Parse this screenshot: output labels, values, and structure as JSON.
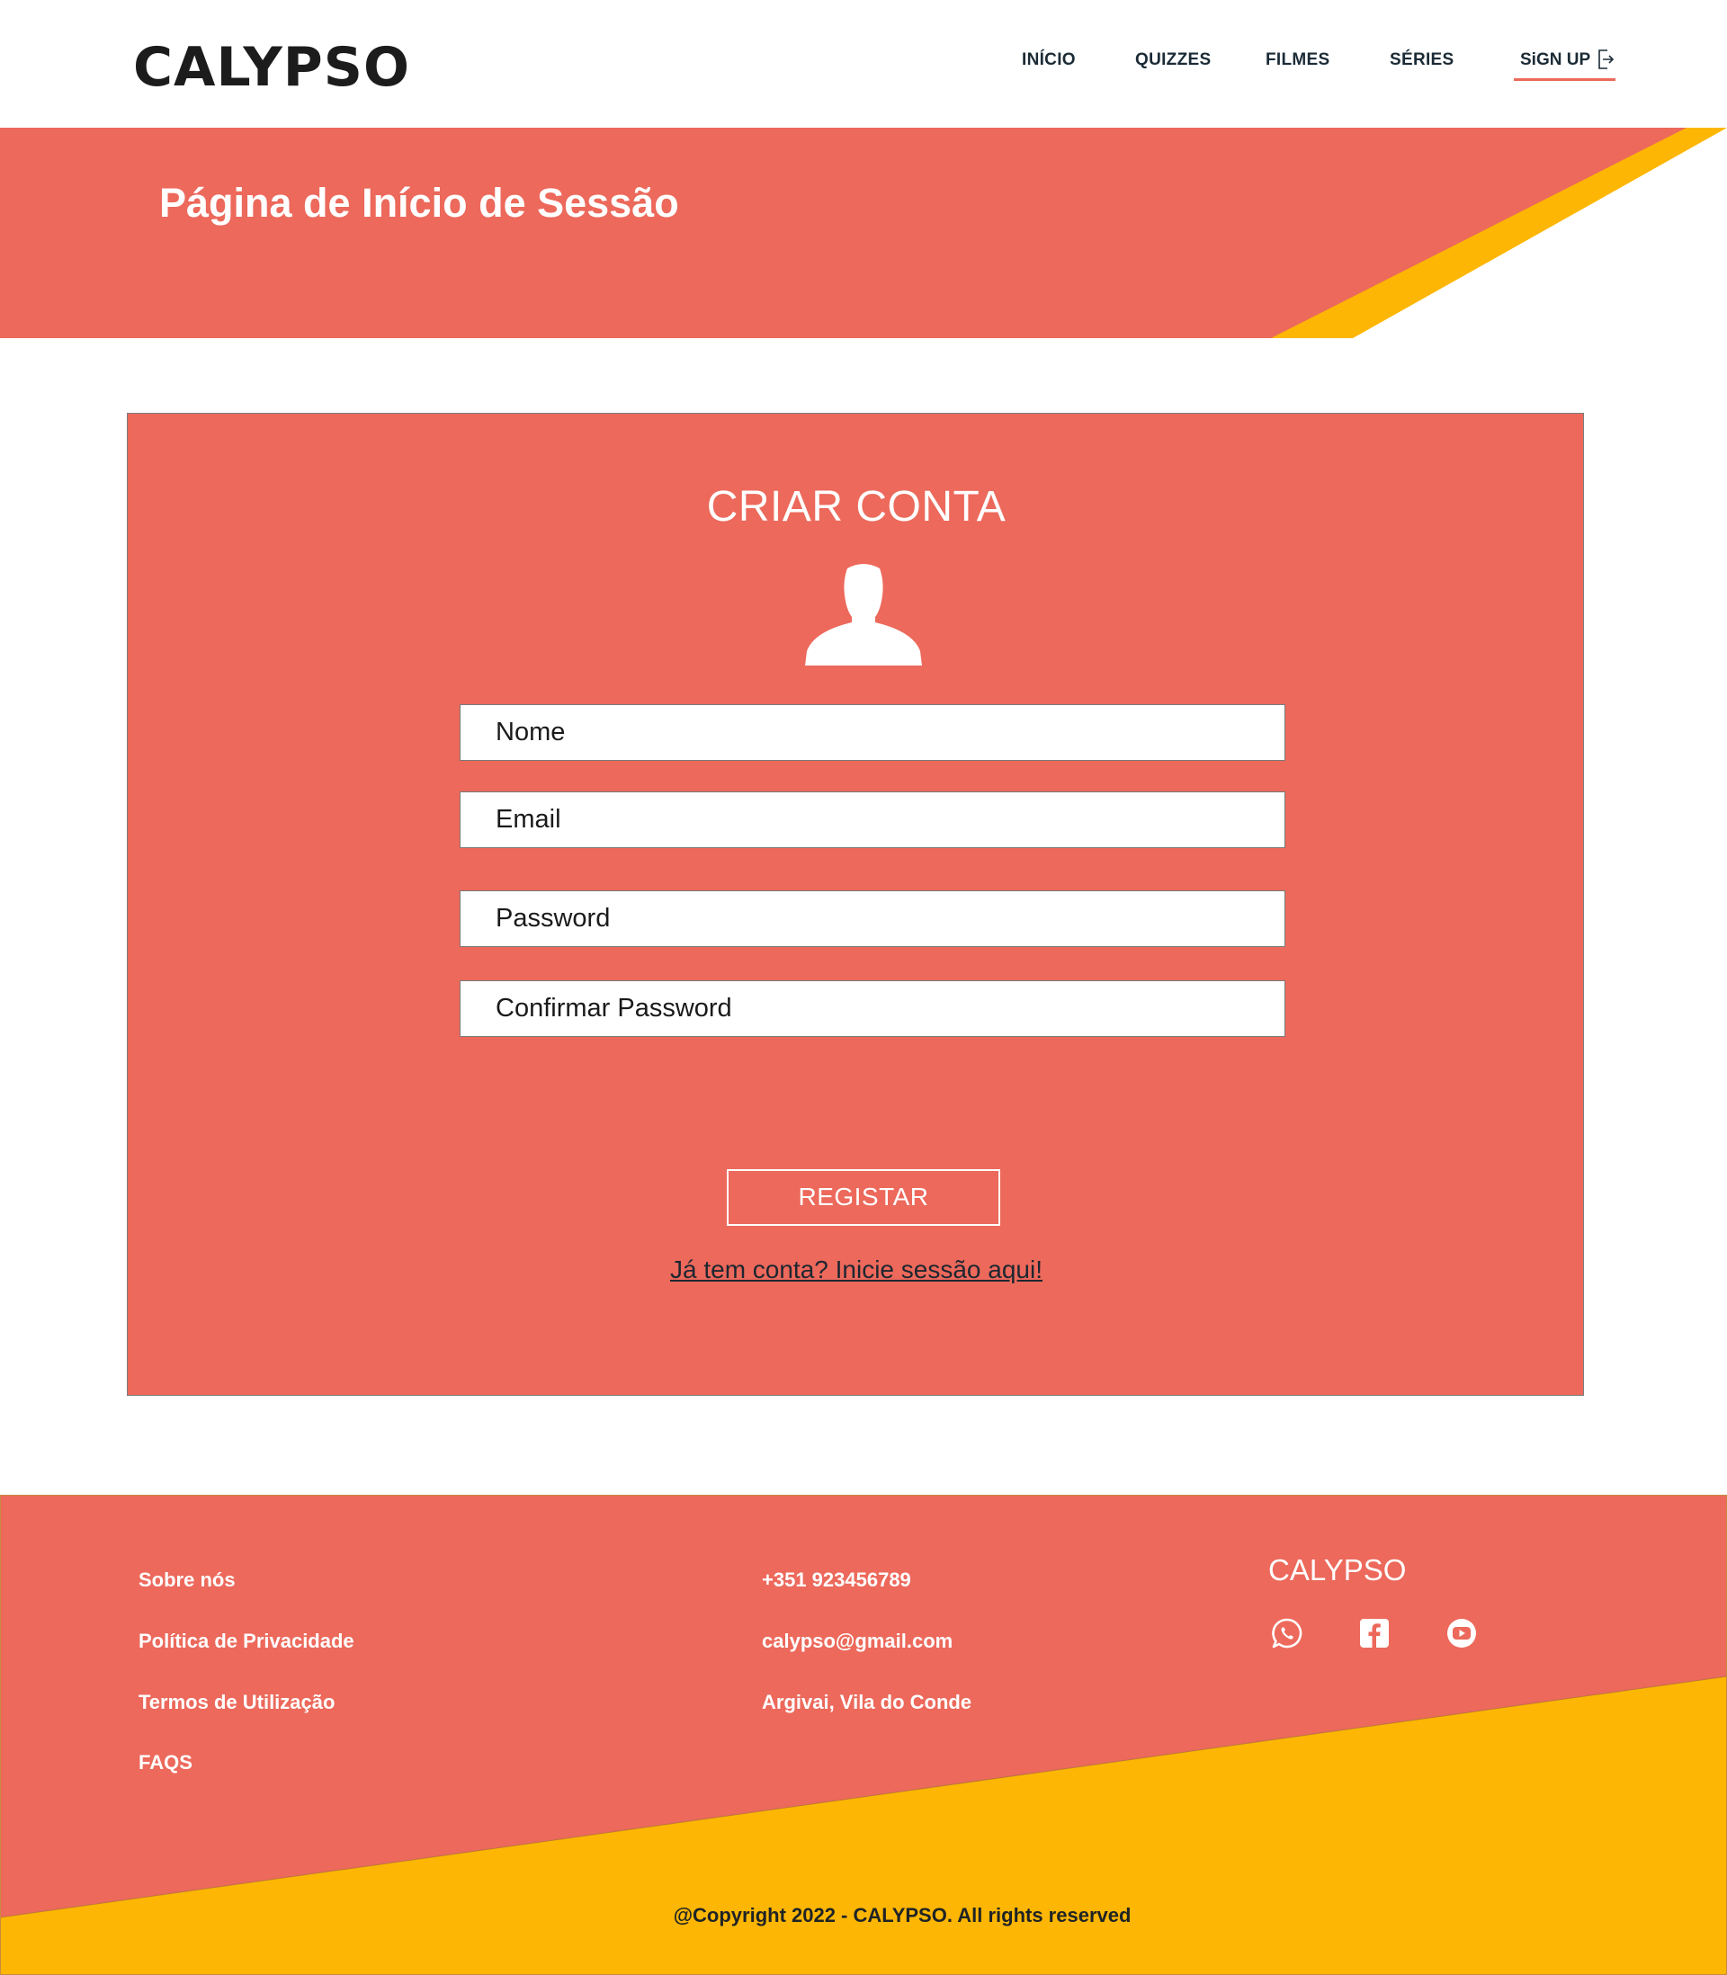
{
  "header": {
    "logo": "CALYPSO",
    "nav": {
      "inicio": "INÍCIO",
      "quizzes": "QUIZZES",
      "filmes": "FILMES",
      "series": "SÉRIES",
      "signup": "SiGN UP"
    }
  },
  "banner": {
    "title": "Página de Início de Sessão"
  },
  "form": {
    "title": "CRIAR CONTA",
    "fields": {
      "nome": "Nome",
      "email": "Email",
      "password": "Password",
      "confirm": "Confirmar Password"
    },
    "register_label": "REGISTAR",
    "login_link": "Já tem conta? Inicie sessão aqui!"
  },
  "footer": {
    "links": [
      "Sobre nós",
      "Política de Privacidade",
      "Termos de Utilização",
      "FAQS"
    ],
    "contact": {
      "phone": "+351 923456789",
      "email": "calypso@gmail.com",
      "address": "Argivai, Vila do Conde"
    },
    "brand": "CALYPSO",
    "social_icons": [
      "whatsapp-icon",
      "facebook-icon",
      "youtube-icon"
    ],
    "copyright": "@Copyright 2022 - CALYPSO. All rights reserved"
  },
  "colors": {
    "coral": "#ec695b",
    "yellow": "#fdb603",
    "dark": "#15232b"
  }
}
